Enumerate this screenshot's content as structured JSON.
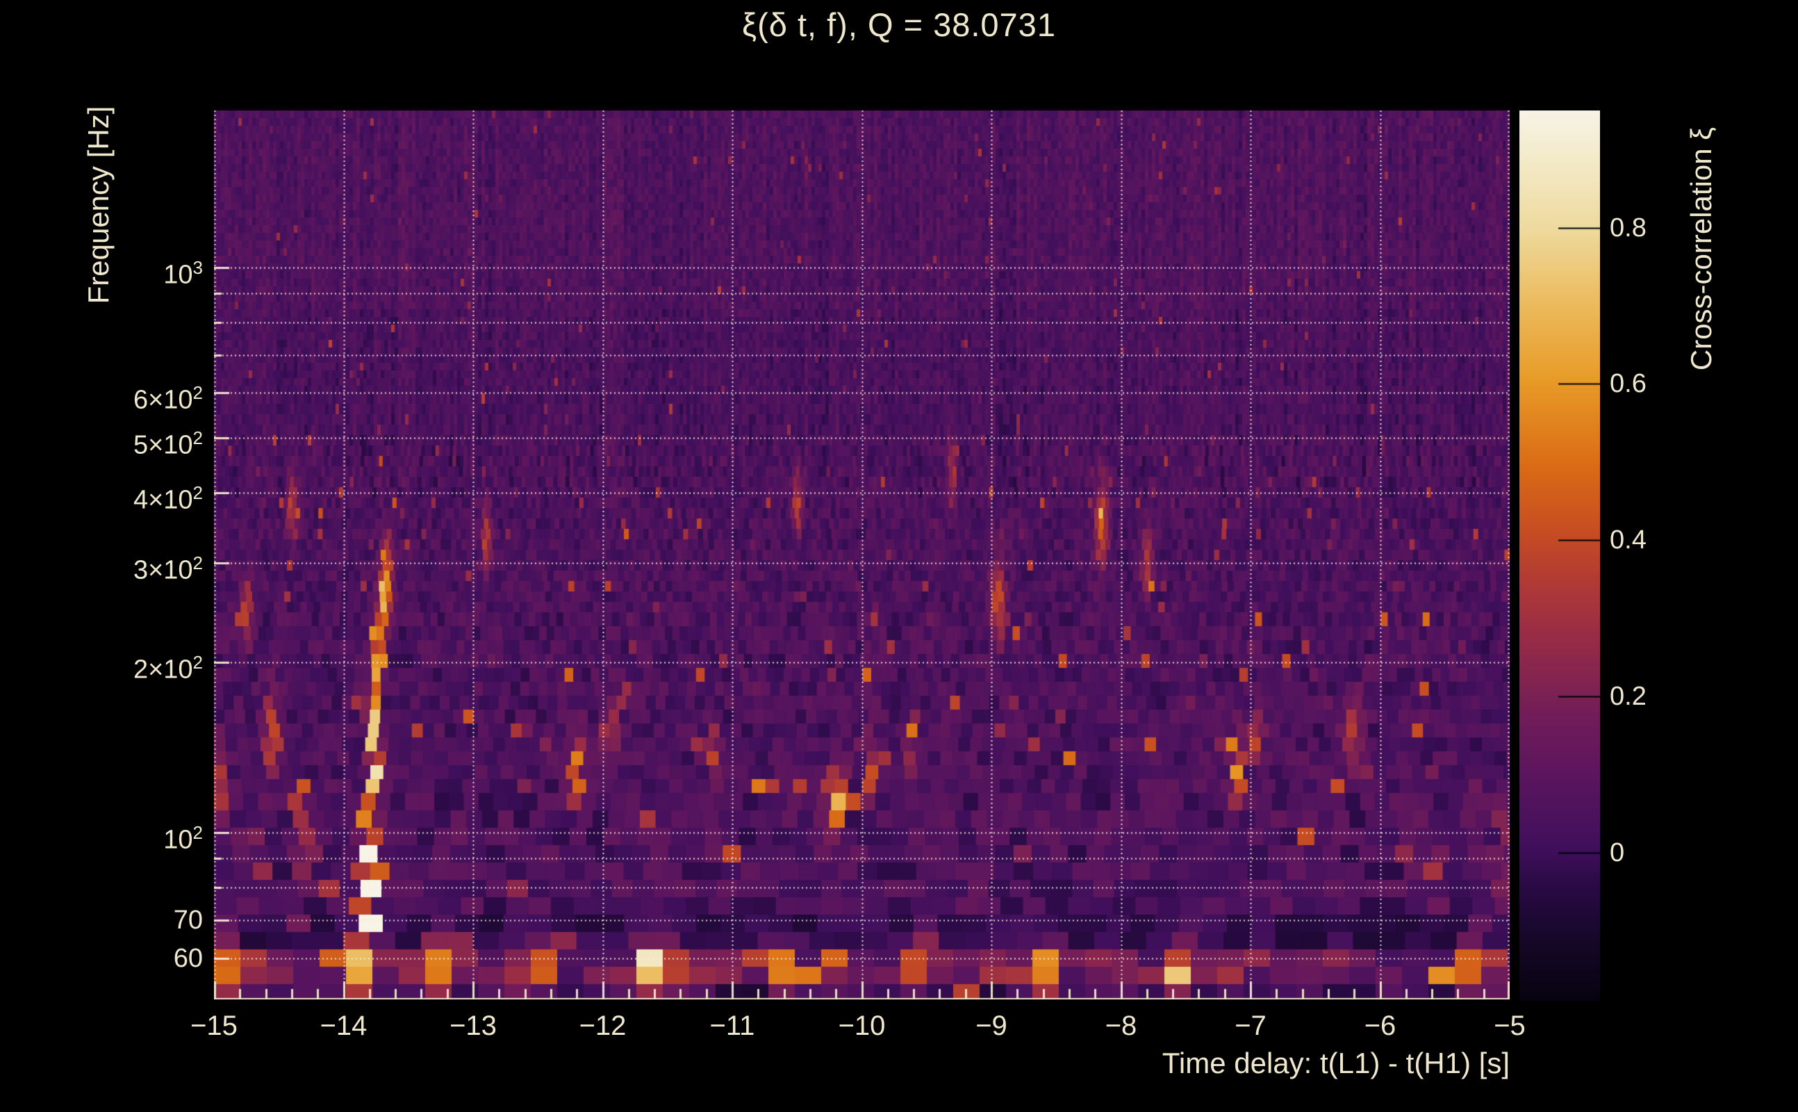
{
  "title": "ξ(δ t, f), Q = 38.0731",
  "axes": {
    "x": {
      "label": "Time delay: t(L1) - t(H1) [s]",
      "ticks": [
        {
          "v": -15,
          "label": "−15"
        },
        {
          "v": -14,
          "label": "−14"
        },
        {
          "v": -13,
          "label": "−13"
        },
        {
          "v": -12,
          "label": "−12"
        },
        {
          "v": -11,
          "label": "−11"
        },
        {
          "v": -10,
          "label": "−10"
        },
        {
          "v": -9,
          "label": "−9"
        },
        {
          "v": -8,
          "label": "−8"
        },
        {
          "v": -7,
          "label": "−7"
        },
        {
          "v": -6,
          "label": "−6"
        },
        {
          "v": -5,
          "label": "−5"
        }
      ]
    },
    "y": {
      "label": "Frequency [Hz]",
      "ticks": [
        {
          "f": 1000,
          "m": "10",
          "e": "3"
        },
        {
          "f": 600,
          "m": "6×10",
          "e": "2"
        },
        {
          "f": 500,
          "m": "5×10",
          "e": "2"
        },
        {
          "f": 400,
          "m": "4×10",
          "e": "2"
        },
        {
          "f": 300,
          "m": "3×10",
          "e": "2"
        },
        {
          "f": 200,
          "m": "2×10",
          "e": "2"
        },
        {
          "f": 100,
          "m": "10",
          "e": "2"
        },
        {
          "f": 70,
          "m": "70",
          "e": ""
        },
        {
          "f": 60,
          "m": "60",
          "e": ""
        }
      ],
      "minor_tick_freqs": [
        900,
        800,
        700,
        90,
        80
      ]
    },
    "colorbar": {
      "label": "Cross-correlation ξ",
      "ticks": [
        {
          "v": 0.8,
          "label": "0.8"
        },
        {
          "v": 0.6,
          "label": "0.6"
        },
        {
          "v": 0.4,
          "label": "0.4"
        },
        {
          "v": 0.2,
          "label": "0.2"
        },
        {
          "v": 0,
          "label": "0"
        }
      ]
    }
  },
  "colors": {
    "background": "#000000",
    "text": "#f0e8cd",
    "grid": "#f6efdc",
    "colorbar_tick": "#000000"
  },
  "chart_data": {
    "type": "heatmap",
    "title": "ξ(δ t, f), Q = 38.0731",
    "xlabel": "Time delay: t(L1) - t(H1) [s]",
    "ylabel": "Frequency [Hz]",
    "zlabel": "Cross-correlation ξ",
    "x_range": [
      -15,
      -5
    ],
    "y_range_hz": [
      50.7,
      1897
    ],
    "y_scale": "log",
    "z_range": [
      -0.19,
      0.95
    ],
    "x_major_tick_step": 1,
    "x_minor_tick_step": 0.2,
    "grid_freqs_hz": [
      60,
      70,
      80,
      90,
      100,
      200,
      300,
      400,
      500,
      600,
      700,
      800,
      900,
      1000
    ],
    "legend_position": "right-colorbar",
    "grid": "dotted",
    "colormap_stops": [
      [
        0.0,
        "#070310"
      ],
      [
        0.07,
        "#160829"
      ],
      [
        0.13,
        "#2a0a45"
      ],
      [
        0.17,
        "#400f5c"
      ],
      [
        0.25,
        "#5a155e"
      ],
      [
        0.32,
        "#711c58"
      ],
      [
        0.345,
        "#7c2153"
      ],
      [
        0.41,
        "#982c46"
      ],
      [
        0.47,
        "#b03a35"
      ],
      [
        0.52,
        "#c44a24"
      ],
      [
        0.6,
        "#da6b15"
      ],
      [
        0.7,
        "#e89c28"
      ],
      [
        0.79,
        "#ecbd62"
      ],
      [
        0.868,
        "#eeda9e"
      ],
      [
        0.94,
        "#f3e9c6"
      ],
      [
        1.0,
        "#f7f3e6"
      ]
    ],
    "noise": {
      "seed": 7,
      "bands": [
        {
          "fmin": 850,
          "fmax": 1897,
          "base": 0.055,
          "sigma": 0.05,
          "p_tail": 0.02,
          "tail": 0.3
        },
        {
          "fmin": 500,
          "fmax": 850,
          "base": 0.04,
          "sigma": 0.05,
          "p_tail": 0.02,
          "tail": 0.3
        },
        {
          "fmin": 250,
          "fmax": 500,
          "base": 0.045,
          "sigma": 0.065,
          "p_tail": 0.05,
          "tail": 0.35
        },
        {
          "fmin": 120,
          "fmax": 250,
          "base": 0.045,
          "sigma": 0.075,
          "p_tail": 0.06,
          "tail": 0.42
        },
        {
          "fmin": 72,
          "fmax": 120,
          "base": 0.045,
          "sigma": 0.085,
          "p_tail": 0.05,
          "tail": 0.4
        },
        {
          "fmin": 61.5,
          "fmax": 72,
          "base": -0.03,
          "sigma": 0.05,
          "p_tail": 0.02,
          "tail": 0.3
        },
        {
          "fmin": 54.5,
          "fmax": 61.5,
          "base": 0.14,
          "sigma": 0.12,
          "p_tail": 0.25,
          "tail": 0.45
        },
        {
          "fmin": 50.7,
          "fmax": 54.5,
          "base": 0.0,
          "sigma": 0.09,
          "p_tail": 0.1,
          "tail": 0.35
        }
      ]
    },
    "features": {
      "description": "Loud chirp-like cluster near t = −13.8 s rising from ~58 Hz to ~290 Hz (peak ξ ≈ 0.95 at 70–100 Hz), persistent bright band near 55–60 Hz across all time delays, scattered ξ ≈ 0.3–0.6 blobs between 90 and 450 Hz",
      "blobs": [
        [
          -13.85,
          58,
          0.6,
          0.1,
          0.08
        ],
        [
          -13.8,
          72,
          1.05,
          0.055,
          0.1
        ],
        [
          -13.82,
          95,
          0.95,
          0.05,
          0.07
        ],
        [
          -13.76,
          128,
          0.85,
          0.045,
          0.06
        ],
        [
          -13.78,
          163,
          0.8,
          0.04,
          0.05
        ],
        [
          -13.74,
          200,
          0.62,
          0.04,
          0.05
        ],
        [
          -13.7,
          243,
          0.5,
          0.045,
          0.06
        ],
        [
          -13.66,
          290,
          0.4,
          0.05,
          0.07
        ],
        [
          -15.0,
          120,
          0.5,
          0.07,
          0.07
        ],
        [
          -14.95,
          57,
          0.5,
          0.09,
          0.07
        ],
        [
          -14.55,
          150,
          0.45,
          0.06,
          0.07
        ],
        [
          -14.4,
          380,
          0.3,
          0.04,
          0.06
        ],
        [
          -14.3,
          95,
          0.35,
          0.07,
          0.06
        ],
        [
          -14.75,
          250,
          0.3,
          0.05,
          0.06
        ],
        [
          -13.3,
          57,
          0.5,
          0.12,
          0.06
        ],
        [
          -12.9,
          330,
          0.3,
          0.04,
          0.06
        ],
        [
          -12.55,
          57,
          0.45,
          0.12,
          0.06
        ],
        [
          -12.2,
          130,
          0.55,
          0.05,
          0.06
        ],
        [
          -11.95,
          152,
          0.35,
          0.05,
          0.05
        ],
        [
          -11.6,
          57,
          0.5,
          0.15,
          0.06
        ],
        [
          -11.15,
          140,
          0.38,
          0.05,
          0.05
        ],
        [
          -10.6,
          57,
          0.4,
          0.1,
          0.06
        ],
        [
          -10.5,
          390,
          0.32,
          0.04,
          0.06
        ],
        [
          -10.2,
          115,
          0.65,
          0.07,
          0.05
        ],
        [
          -9.95,
          128,
          0.5,
          0.04,
          0.05
        ],
        [
          -9.62,
          148,
          0.45,
          0.04,
          0.05
        ],
        [
          -9.55,
          60,
          0.4,
          0.1,
          0.06
        ],
        [
          -9.3,
          430,
          0.28,
          0.04,
          0.06
        ],
        [
          -8.95,
          260,
          0.42,
          0.05,
          0.07
        ],
        [
          -8.6,
          57,
          0.45,
          0.12,
          0.06
        ],
        [
          -8.15,
          350,
          0.4,
          0.05,
          0.08
        ],
        [
          -7.8,
          300,
          0.3,
          0.04,
          0.06
        ],
        [
          -7.5,
          57,
          0.42,
          0.1,
          0.06
        ],
        [
          -7.1,
          130,
          0.5,
          0.05,
          0.06
        ],
        [
          -6.95,
          148,
          0.4,
          0.04,
          0.05
        ],
        [
          -6.2,
          150,
          0.38,
          0.05,
          0.06
        ],
        [
          -5.6,
          90,
          0.35,
          0.06,
          0.06
        ],
        [
          -5.25,
          57,
          0.55,
          0.1,
          0.07
        ],
        [
          -5.05,
          95,
          0.4,
          0.05,
          0.06
        ]
      ]
    }
  }
}
